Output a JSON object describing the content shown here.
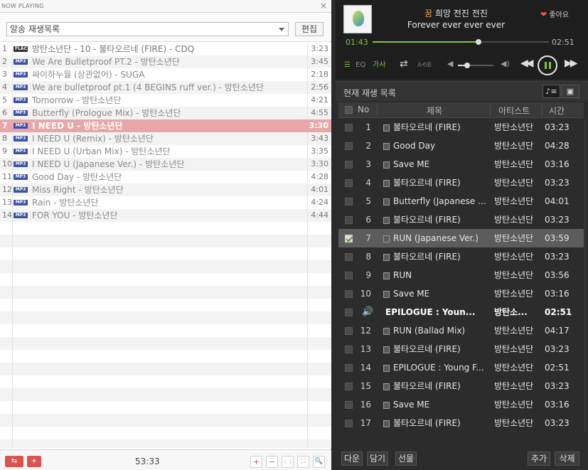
{
  "left": {
    "title": "NOW PLAYING",
    "close": "×",
    "playlist_select": "알송 재생목록",
    "edit_button": "편집",
    "tracks": [
      {
        "num": "1",
        "fmt": "FLAC",
        "title": "방탄소년단 - 10 - 불타오르네 (FIRE) - CDQ",
        "dur": "3:23"
      },
      {
        "num": "2",
        "fmt": "MP3",
        "title": "We Are Bulletproof PT.2 - 방탄소년단",
        "dur": "3:45"
      },
      {
        "num": "3",
        "fmt": "MP3",
        "title": "싸이하누월 (상관없어) - SUGA",
        "dur": "2:18"
      },
      {
        "num": "4",
        "fmt": "MP3",
        "title": "We are bulletproof pt.1 (4 BEGINS ruff ver.) - 방탄소년단",
        "dur": "2:56"
      },
      {
        "num": "5",
        "fmt": "MP3",
        "title": "Tomorrow - 방탄소년단",
        "dur": "4:21"
      },
      {
        "num": "6",
        "fmt": "MP3",
        "title": "Butterfly (Prologue Mix) - 방탄소년단",
        "dur": "4:55"
      },
      {
        "num": "7",
        "fmt": "MP3",
        "title": "I NEED U - 방탄소년단",
        "dur": "3:30"
      },
      {
        "num": "8",
        "fmt": "MP3",
        "title": "I NEED U (Remix) - 방탄소년단",
        "dur": "3:43"
      },
      {
        "num": "9",
        "fmt": "MP3",
        "title": "I NEED U (Urban Mix) - 방탄소년단",
        "dur": "3:35"
      },
      {
        "num": "10",
        "fmt": "MP3",
        "title": "I NEED U (Japanese Ver.) - 방탄소년단",
        "dur": "3:30"
      },
      {
        "num": "11",
        "fmt": "MP3",
        "title": "Good Day - 방탄소년단",
        "dur": "4:28"
      },
      {
        "num": "12",
        "fmt": "MP3",
        "title": "Miss Right - 방탄소년단",
        "dur": "4:01"
      },
      {
        "num": "13",
        "fmt": "MP3",
        "title": "Rain - 방탄소년단",
        "dur": "4:24"
      },
      {
        "num": "14",
        "fmt": "MP3",
        "title": "FOR YOU - 방탄소년단",
        "dur": "4:44"
      }
    ],
    "active_track_index": 6,
    "total_time": "53:33",
    "footer_buttons": [
      "+",
      "−",
      "⋮⋮",
      "⛶",
      "🔍"
    ]
  },
  "right": {
    "now_title_kw": "꿈",
    "now_title_rest": " 희망 전진 전진",
    "now_artist": "Forever ever ever ever",
    "like_label": "좋아요",
    "time_current": "01:43",
    "time_total": "02:51",
    "progress": 0.6,
    "volume": 0.25,
    "eq_label": "EQ",
    "lyrics_label": "가사",
    "ab_label": "A⟲B",
    "queue_title": "현재 재생 목록",
    "cols": {
      "no": "No",
      "title": "제목",
      "artist": "아티스트",
      "time": "시간"
    },
    "queue": [
      {
        "no": "1",
        "title": "불타오르네 (FIRE)",
        "artist": "방탄소년단",
        "time": "03:23"
      },
      {
        "no": "2",
        "title": "Good Day",
        "artist": "방탄소년단",
        "time": "04:28"
      },
      {
        "no": "3",
        "title": "Save ME",
        "artist": "방탄소년단",
        "time": "03:16"
      },
      {
        "no": "4",
        "title": "불타오르네 (FIRE)",
        "artist": "방탄소년단",
        "time": "03:23"
      },
      {
        "no": "5",
        "title": "Butterfly (Japanese V...",
        "artist": "방탄소년단",
        "time": "04:01"
      },
      {
        "no": "6",
        "title": "불타오르네 (FIRE)",
        "artist": "방탄소년단",
        "time": "03:23"
      },
      {
        "no": "7",
        "title": "RUN (Japanese Ver.)",
        "artist": "방탄소년단",
        "time": "03:59"
      },
      {
        "no": "8",
        "title": "불타오르네 (FIRE)",
        "artist": "방탄소년단",
        "time": "03:23"
      },
      {
        "no": "9",
        "title": "RUN",
        "artist": "방탄소년단",
        "time": "03:56"
      },
      {
        "no": "10",
        "title": "Save ME",
        "artist": "방탄소년단",
        "time": "03:16"
      },
      {
        "no": "",
        "title": "EPILOGUE : Youn...",
        "artist": "방탄소...",
        "time": "02:51"
      },
      {
        "no": "12",
        "title": "RUN (Ballad Mix)",
        "artist": "방탄소년단",
        "time": "04:17"
      },
      {
        "no": "13",
        "title": "불타오르네 (FIRE)",
        "artist": "방탄소년단",
        "time": "03:23"
      },
      {
        "no": "14",
        "title": "EPILOGUE : Young F...",
        "artist": "방탄소년단",
        "time": "02:51"
      },
      {
        "no": "15",
        "title": "불타오르네 (FIRE)",
        "artist": "방탄소년단",
        "time": "03:23"
      },
      {
        "no": "16",
        "title": "Save ME",
        "artist": "방탄소년단",
        "time": "03:16"
      },
      {
        "no": "17",
        "title": "불타오르네 (FIRE)",
        "artist": "방탄소년단",
        "time": "03:23"
      }
    ],
    "selected_index": 6,
    "playing_index": 10,
    "footer": {
      "b1": "다운",
      "b2": "담기",
      "b3": "선물",
      "b4": "추가",
      "b5": "삭제"
    }
  },
  "colors": {
    "accent_green": "#7ec43a",
    "active_row": "#e8a6a8",
    "brand_red": "#d9534f"
  }
}
